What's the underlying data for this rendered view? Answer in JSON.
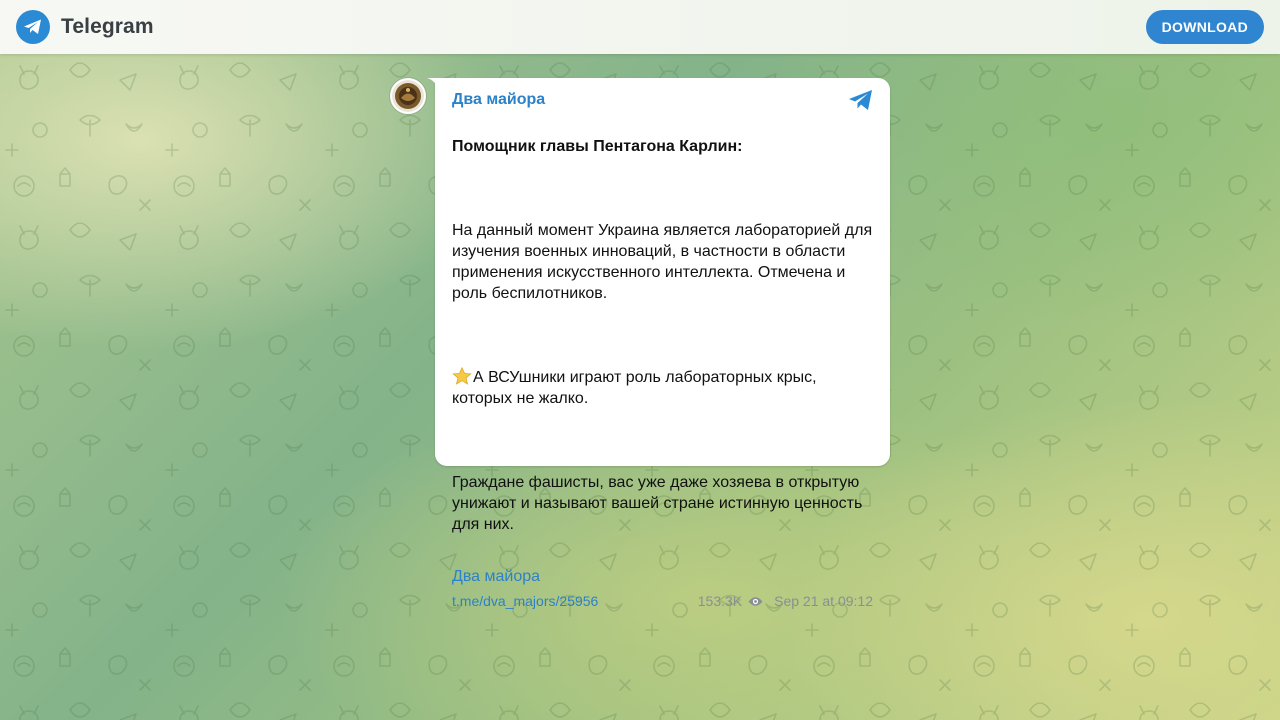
{
  "header": {
    "brand": "Telegram",
    "download_label": "DOWNLOAD"
  },
  "post": {
    "channel_name": "Два майора",
    "title": "Помощник главы Пентагона Карлин:",
    "paragraph1": "На данный момент Украина является лабораторией для изучения военных инноваций, в частности в области применения искусственного интеллекта. Отмечена и роль беспилотников.",
    "paragraph2": "А ВСУшники играют роль лабораторных крыс, которых не жалко.",
    "paragraph3": "Граждане фашисты, вас уже даже хозяева в открытую унижают и называют вашей стране истинную ценность для них.",
    "signature": "Два майора",
    "link": "t.me/dva_majors/25956",
    "views": "153.3K",
    "date": "Sep 21 at 09:12"
  },
  "icons": {
    "logo": "telegram-logo-icon",
    "corner": "telegram-plane-icon",
    "star": "star-emoji-icon",
    "eye": "eye-icon"
  },
  "colors": {
    "accent": "#2b82c8",
    "button": "#2f85d0",
    "logo_bg": "#2a8ad3"
  }
}
